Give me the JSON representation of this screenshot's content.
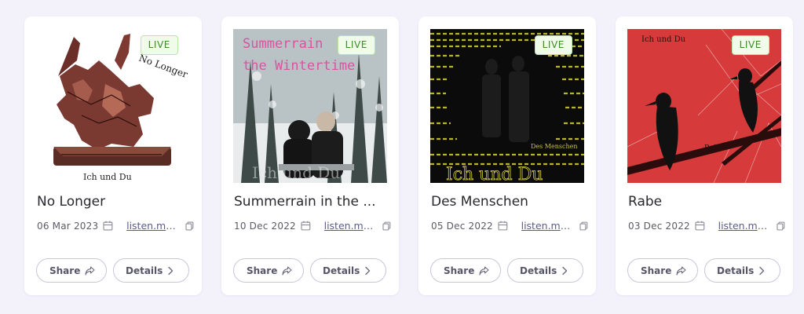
{
  "releases": [
    {
      "title": "No Longer",
      "status": "LIVE",
      "date": "06 Mar 2023",
      "link": "listen.mu...",
      "share_label": "Share",
      "details_label": "Details",
      "cover_text_top": "No Longer",
      "cover_text_bottom": "Ich und Du"
    },
    {
      "title": "Summerrain in the ...",
      "status": "LIVE",
      "date": "10 Dec 2022",
      "link": "listen.mu...",
      "share_label": "Share",
      "details_label": "Details",
      "cover_text_top": "Summerrain in the Wintertime",
      "cover_text_bottom": "Ich und Du"
    },
    {
      "title": "Des Menschen",
      "status": "LIVE",
      "date": "05 Dec 2022",
      "link": "listen.mu...",
      "share_label": "Share",
      "details_label": "Details",
      "cover_text_top": "Des Menschen",
      "cover_text_bottom": "Ich und Du"
    },
    {
      "title": "Rabe",
      "status": "LIVE",
      "date": "03 Dec 2022",
      "link": "listen.mu...",
      "share_label": "Share",
      "details_label": "Details",
      "cover_text_top": "Ich und Du",
      "cover_text_bottom": "Rabe"
    }
  ],
  "icons": {
    "date": "calendar-icon",
    "link": "copy-icon",
    "share": "share-arrow-icon",
    "details": "chevron-right-icon"
  },
  "colors": {
    "background": "#f3f2fb",
    "live_badge_bg": "#f1fbe9",
    "live_badge_text": "#3e8c28",
    "button_border": "#c6c6dd"
  }
}
